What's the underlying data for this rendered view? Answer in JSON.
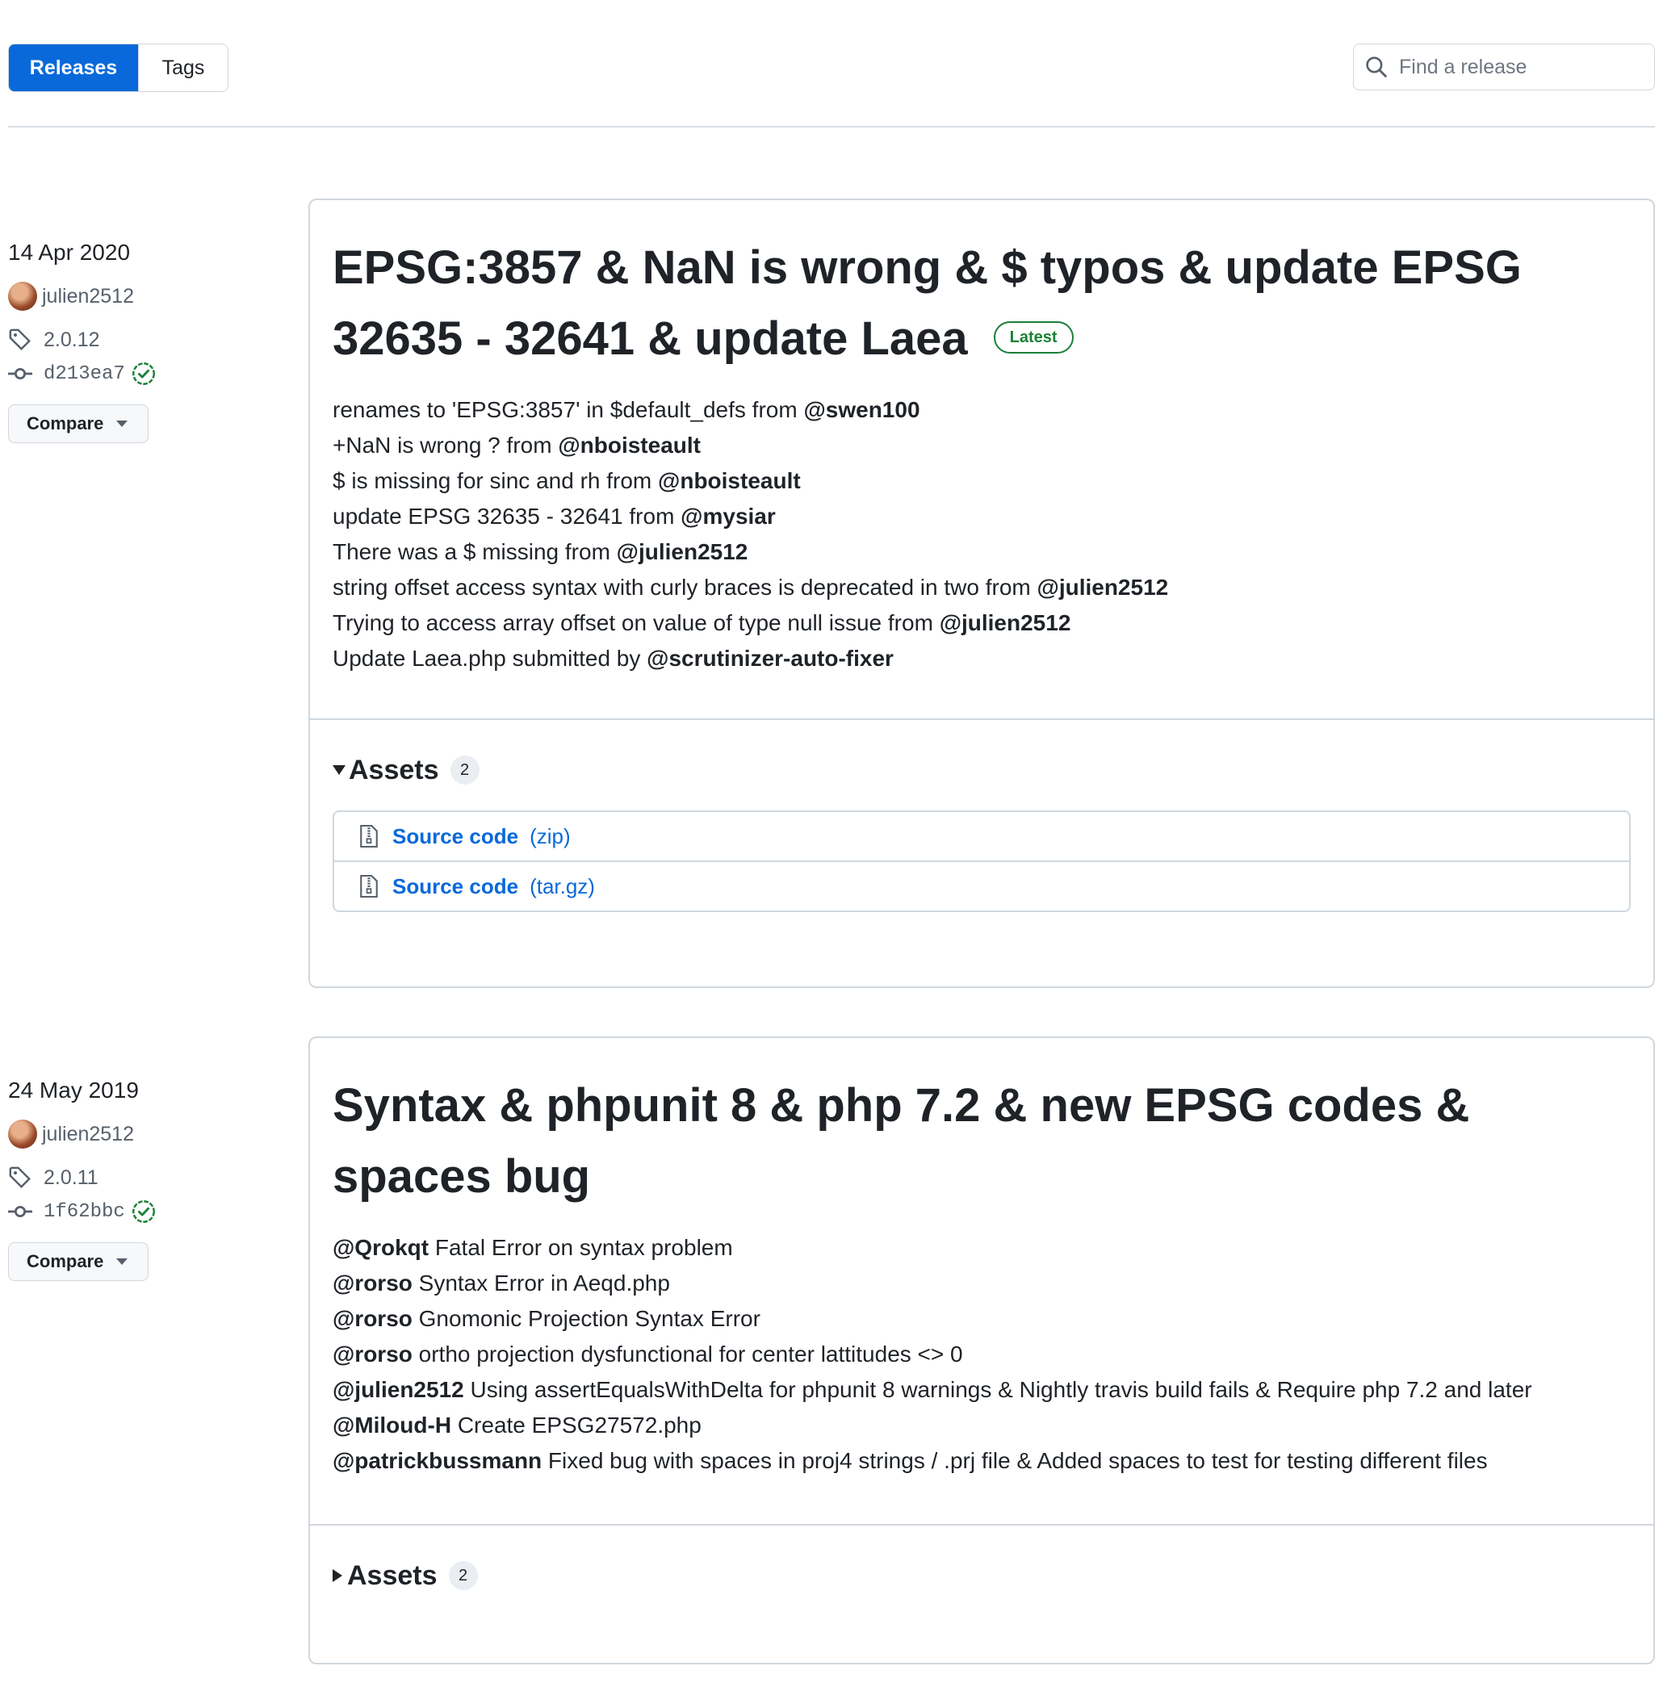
{
  "tabs": {
    "releases": "Releases",
    "tags": "Tags"
  },
  "search": {
    "placeholder": "Find a release"
  },
  "releases": [
    {
      "date": "14 Apr 2020",
      "author": "julien2512",
      "tag": "2.0.12",
      "commit": "d213ea7",
      "compare_label": "Compare",
      "title": "EPSG:3857 & NaN is wrong & $ typos & update EPSG 32635 - 32641 & update Laea",
      "badge": "Latest",
      "notes": [
        {
          "pre": "renames to 'EPSG:3857' in $default_defs from ",
          "mention": "@swen100",
          "post": ""
        },
        {
          "pre": "+NaN is wrong ? from ",
          "mention": "@nboisteault",
          "post": ""
        },
        {
          "pre": "$ is missing for sinc and rh from ",
          "mention": "@nboisteault",
          "post": ""
        },
        {
          "pre": "update EPSG 32635 - 32641 from ",
          "mention": "@mysiar",
          "post": ""
        },
        {
          "pre": "There was a $ missing from ",
          "mention": "@julien2512",
          "post": ""
        },
        {
          "pre": "string offset access syntax with curly braces is deprecated in two from ",
          "mention": "@julien2512",
          "post": ""
        },
        {
          "pre": "Trying to access array offset on value of type null issue from ",
          "mention": "@julien2512",
          "post": ""
        },
        {
          "pre": "Update Laea.php submitted by ",
          "mention": "@scrutinizer-auto-fixer",
          "post": ""
        }
      ],
      "assets_label": "Assets",
      "assets_count": "2",
      "assets": [
        {
          "name": "Source code",
          "ext": "(zip)"
        },
        {
          "name": "Source code",
          "ext": "(tar.gz)"
        }
      ]
    },
    {
      "date": "24 May 2019",
      "author": "julien2512",
      "tag": "2.0.11",
      "commit": "1f62bbc",
      "compare_label": "Compare",
      "title": "Syntax & phpunit 8 & php 7.2 & new EPSG codes & spaces bug",
      "notes": [
        {
          "pre": "",
          "mention": "@Qrokqt",
          "post": " Fatal Error on syntax problem"
        },
        {
          "pre": "",
          "mention": "@rorso",
          "post": " Syntax Error in Aeqd.php"
        },
        {
          "pre": "",
          "mention": "@rorso",
          "post": " Gnomonic Projection Syntax Error"
        },
        {
          "pre": "",
          "mention": "@rorso",
          "post": " ortho projection dysfunctional for center lattitudes <> 0"
        },
        {
          "pre": "",
          "mention": "@julien2512",
          "post": " Using assertEqualsWithDelta for phpunit 8 warnings & Nightly travis build fails & Require php 7.2 and later"
        },
        {
          "pre": "",
          "mention": "@Miloud-H",
          "post": " Create EPSG27572.php"
        },
        {
          "pre": "",
          "mention": "@patrickbussmann",
          "post": " Fixed bug with spaces in proj4 strings / .prj file & Added spaces to test for testing different files"
        }
      ],
      "assets_label": "Assets",
      "assets_count": "2"
    }
  ]
}
